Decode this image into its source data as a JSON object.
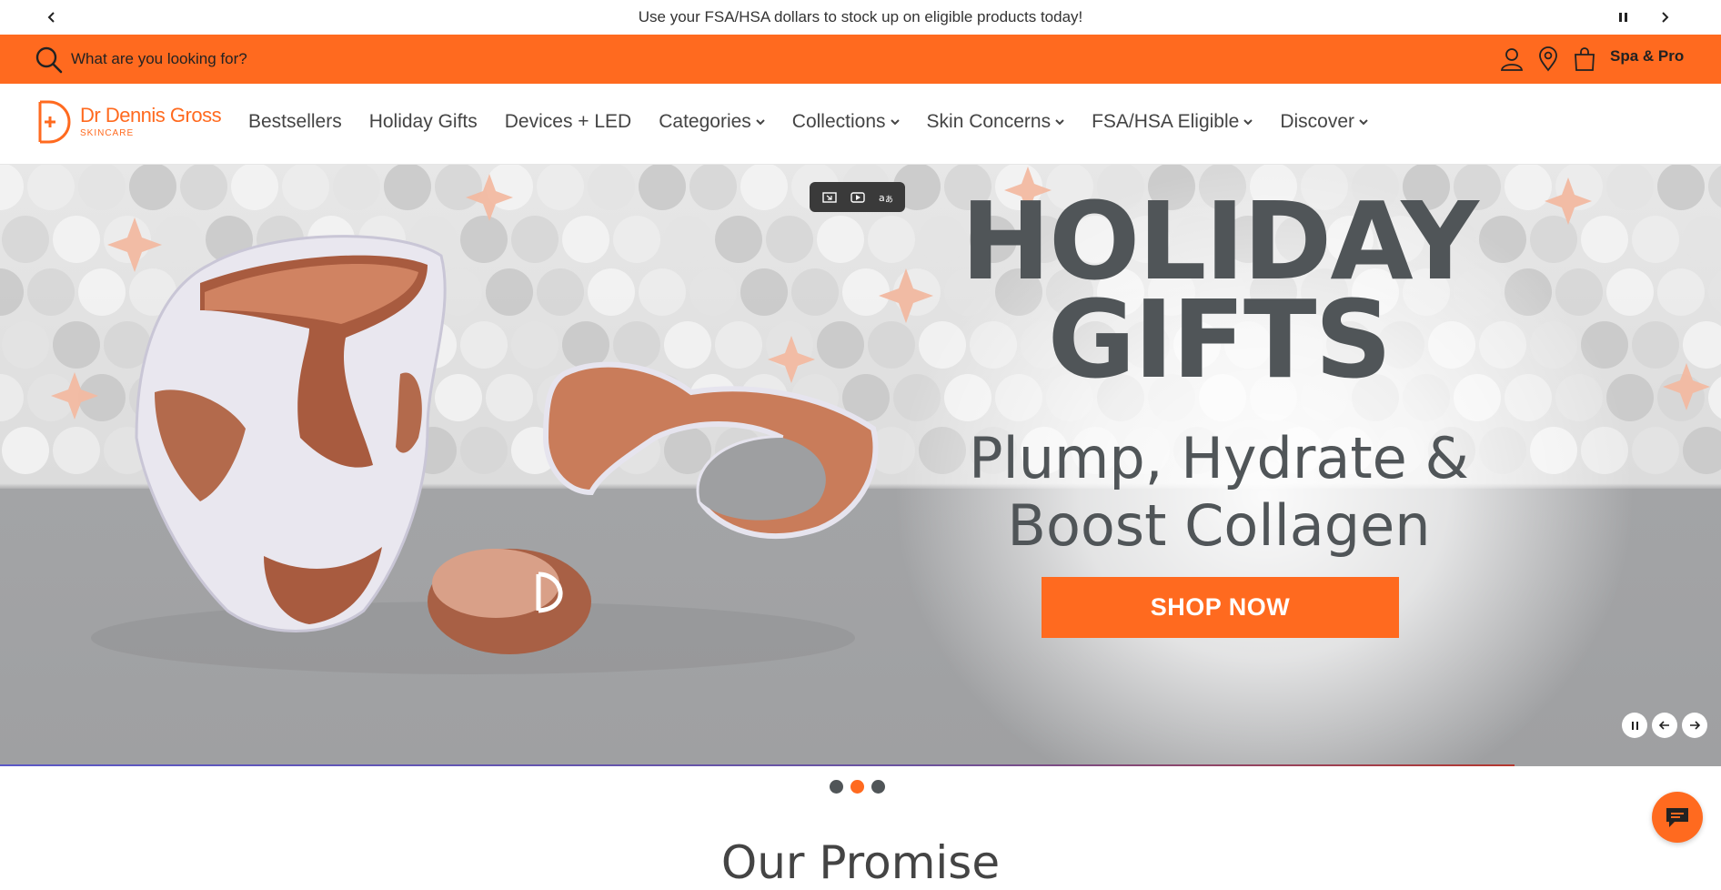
{
  "announcement": {
    "message": "Use your FSA/HSA dollars to stock up on eligible products today!",
    "prev_icon": "chevron-left-icon",
    "next_icon": "chevron-right-icon",
    "pause_icon": "pause-icon"
  },
  "search": {
    "placeholder": "What are you looking for?",
    "icon": "search-icon"
  },
  "utility": {
    "account_icon": "user-icon",
    "store_icon": "location-pin-icon",
    "bag_icon": "shopping-bag-icon",
    "spa_pro_label": "Spa & Pro"
  },
  "brand": {
    "name": "Dr Dennis Gross",
    "sub": "SKINCARE",
    "color": "#ff6a1f"
  },
  "nav": {
    "items": [
      {
        "label": "Bestsellers",
        "dropdown": false
      },
      {
        "label": "Holiday Gifts",
        "dropdown": false
      },
      {
        "label": "Devices + LED",
        "dropdown": false
      },
      {
        "label": "Categories",
        "dropdown": true
      },
      {
        "label": "Collections",
        "dropdown": true
      },
      {
        "label": "Skin Concerns",
        "dropdown": true
      },
      {
        "label": "FSA/HSA Eligible",
        "dropdown": true
      },
      {
        "label": "Discover",
        "dropdown": true
      }
    ]
  },
  "hero": {
    "title_line1": "HOLIDAY",
    "title_line2": "GIFTS",
    "subtitle_line1": "Plump, Hydrate &",
    "subtitle_line2": "Boost Collagen",
    "cta": "SHOP NOW",
    "cta_color": "#ff6a1f",
    "text_color": "#505558",
    "controls": {
      "pause_icon": "pause-icon",
      "prev_icon": "arrow-left-icon",
      "next_icon": "arrow-right-icon"
    }
  },
  "carousel": {
    "slide_count": 3,
    "active_index": 1
  },
  "floating_toolbar": {
    "icons": [
      "screen-capture-icon",
      "video-capture-icon",
      "translate-icon"
    ]
  },
  "section": {
    "heading_partial": "Our Promise"
  },
  "chat": {
    "icon": "chat-bubble-icon"
  }
}
